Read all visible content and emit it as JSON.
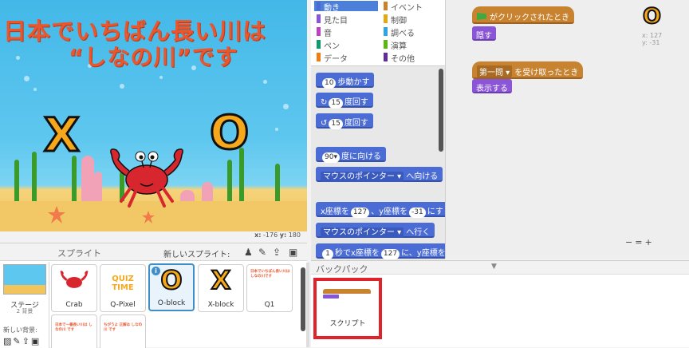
{
  "stage": {
    "title_line1": "日本でいちばん長い川は",
    "title_line2": "“しなの川”です",
    "letter_x": "X",
    "letter_o": "O",
    "mouse_x_label": "x:",
    "mouse_x": "-176",
    "mouse_y_label": "y:",
    "mouse_y": "180"
  },
  "sprites": {
    "title": "スプライト",
    "new_sprite_label": "新しいスプライト:",
    "stage_label": "ステージ",
    "stage_backdrop_count": "2 背景",
    "new_backdrop_label": "新しい背景:",
    "items": [
      {
        "name": "Crab"
      },
      {
        "name": "Q-Pixel",
        "art": "QUIZ TIME"
      },
      {
        "name": "O-block",
        "art": "O",
        "selected": true
      },
      {
        "name": "X-block",
        "art": "X"
      },
      {
        "name": "Q1",
        "art": "日本でいちばん長い川は しなの川です"
      },
      {
        "name": "",
        "art": "日本で一番長い川は しなの川 です"
      },
      {
        "name": "",
        "art": "ちがうよ 正解は しなの川 です"
      }
    ]
  },
  "palette": {
    "categories": [
      {
        "label": "動き",
        "color": "#4a6cd4",
        "active": true
      },
      {
        "label": "イベント",
        "color": "#c88330"
      },
      {
        "label": "見た目",
        "color": "#8a55d7"
      },
      {
        "label": "制御",
        "color": "#e1a91a"
      },
      {
        "label": "音",
        "color": "#bb42c3"
      },
      {
        "label": "調べる",
        "color": "#2ca5e2"
      },
      {
        "label": "ペン",
        "color": "#0e9a6c"
      },
      {
        "label": "演算",
        "color": "#5cb712"
      },
      {
        "label": "データ",
        "color": "#ee7d16"
      },
      {
        "label": "その他",
        "color": "#632d99"
      }
    ],
    "blocks": {
      "move_steps": "10",
      "move_label": "歩動かす",
      "turn_right_deg": "15",
      "turn_right_label": "度回す",
      "turn_left_deg": "15",
      "turn_left_label": "度回す",
      "point_dir": "90▾",
      "point_dir_label": "度に向ける",
      "point_towards_menu": "マウスのポインター",
      "point_towards_label": "へ向ける",
      "goto_xy_x_label": "x座標を",
      "goto_xy_x": "127",
      "goto_xy_y_label": "、y座標を",
      "goto_xy_y": "-31",
      "goto_xy_end": "にす",
      "goto_menu": "マウスのポインター",
      "goto_label": "へ行く",
      "glide_secs": "1",
      "glide_label_a": "秒でx座標を",
      "glide_x": "127",
      "glide_label_b": "に、y座標を"
    }
  },
  "script": {
    "hat1_label": "がクリックされたとき",
    "block1_label": "隠す",
    "hat2_message": "第一問",
    "hat2_label": "を受け取ったとき",
    "block2_label": "表示する",
    "sprite_preview": "O",
    "sprite_x": "x: 127",
    "sprite_y": "y: -31",
    "zoom_out": "−",
    "zoom_reset": "=",
    "zoom_in": "+"
  },
  "backpack": {
    "title": "バックパック",
    "item_label": "スクリプト"
  },
  "colors": {
    "stage_title": "#e8572e",
    "motion": "#4a6cd4",
    "events": "#c88330",
    "looks": "#8a55d7",
    "highlight": "#e0232b"
  }
}
